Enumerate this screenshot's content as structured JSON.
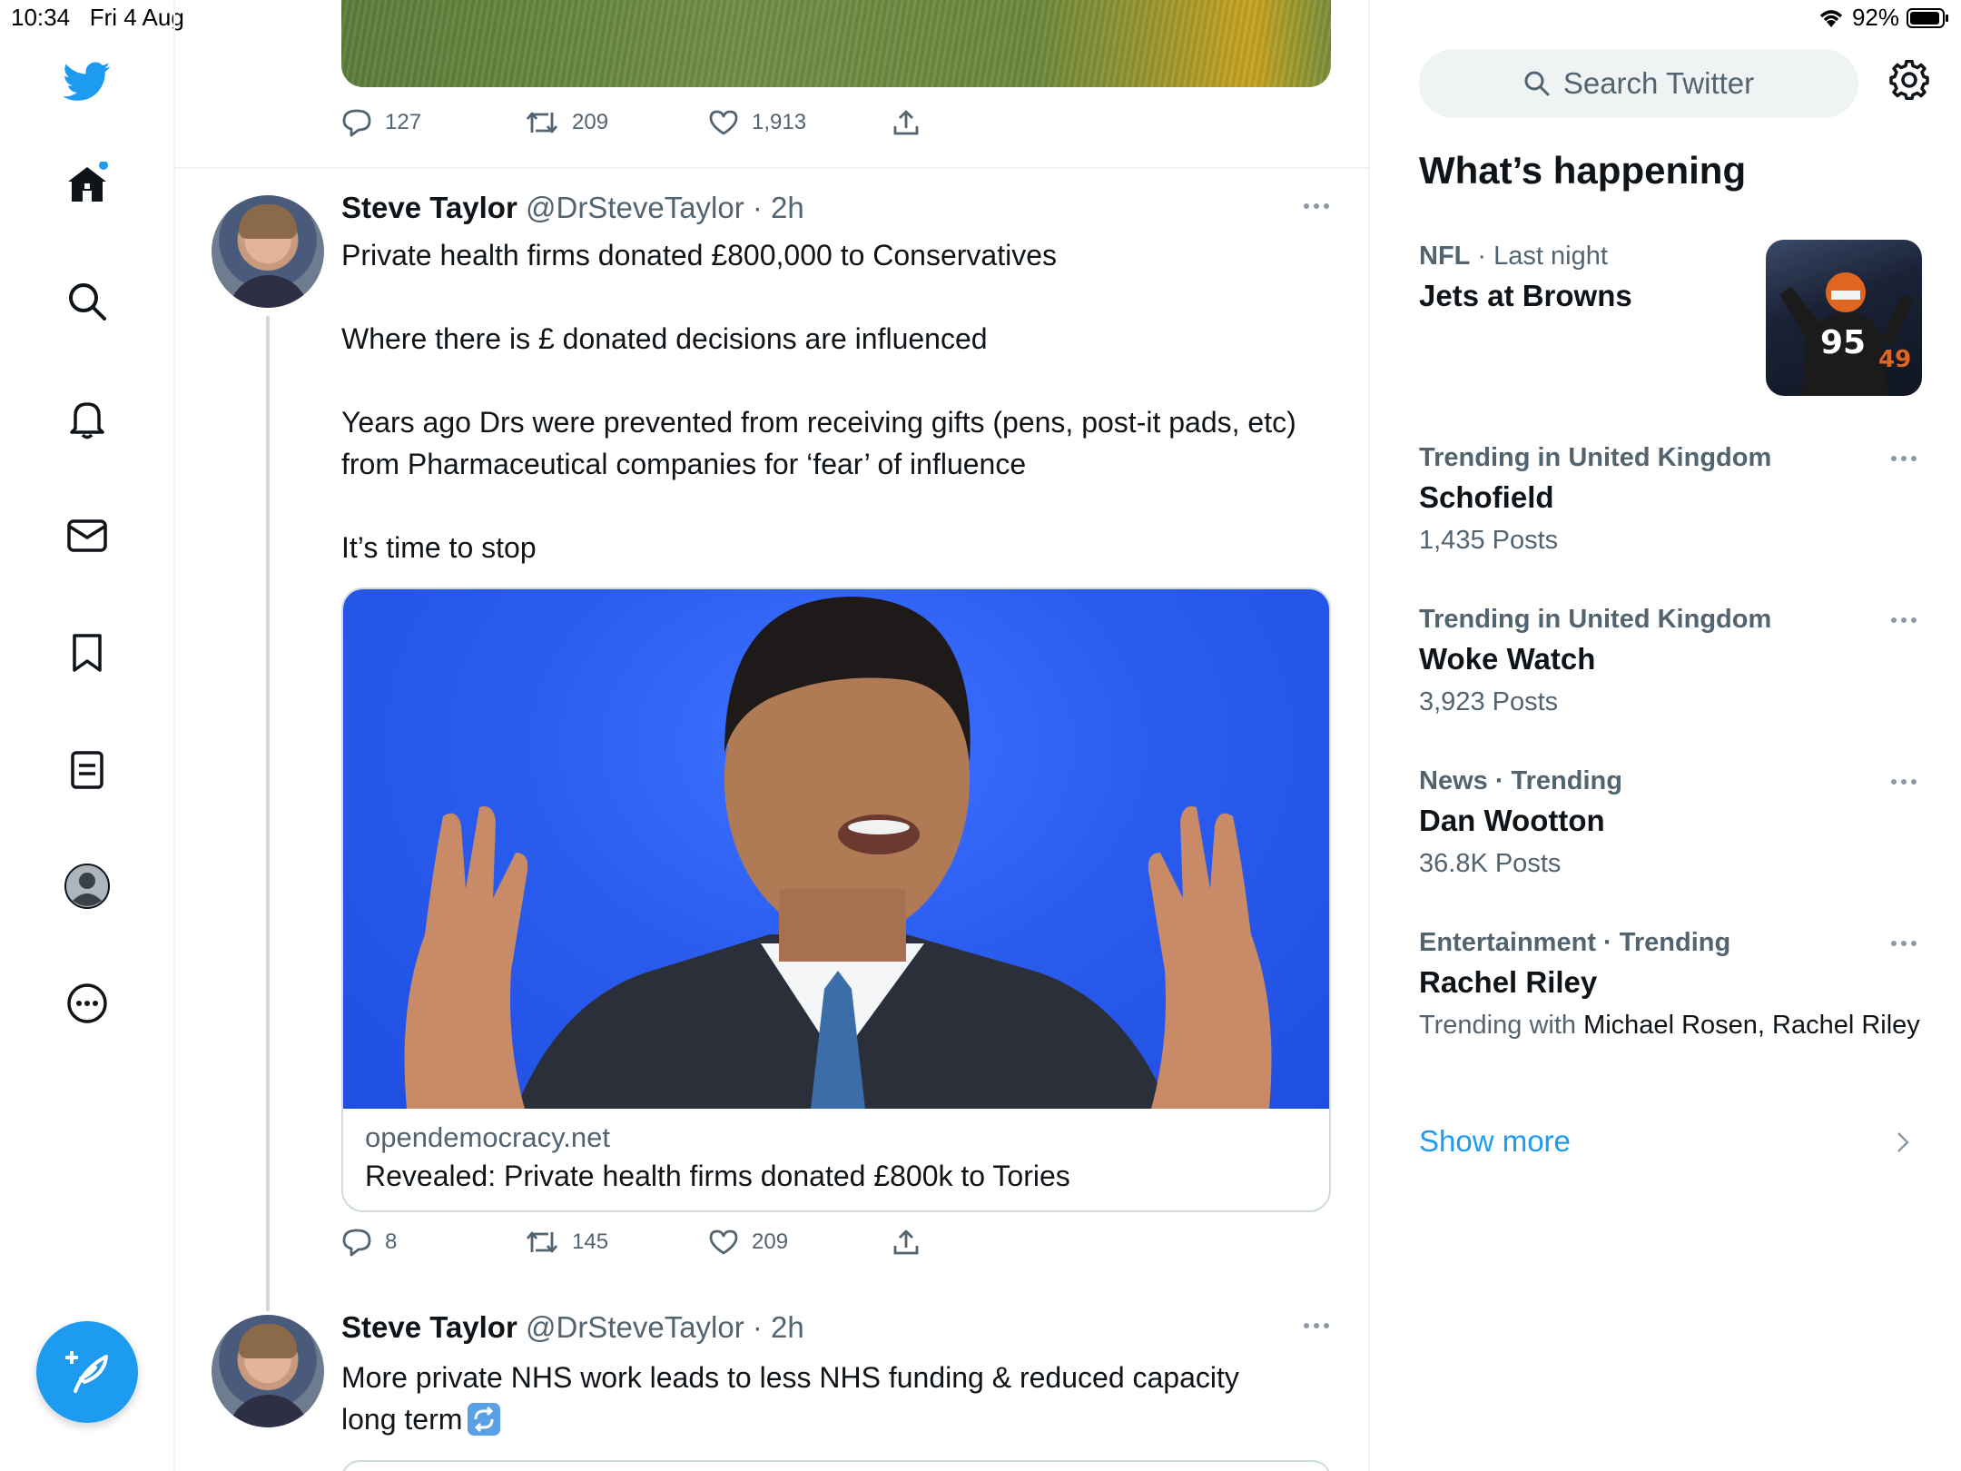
{
  "status_bar": {
    "time": "10:34",
    "date": "Fri 4 Aug",
    "battery": "92%"
  },
  "colors": {
    "accent": "#1d9bf0",
    "text": "#0f1419",
    "secondary": "#536471",
    "border": "#eff3f4"
  },
  "nav": {
    "items": [
      {
        "icon": "twitter-bird-icon"
      },
      {
        "icon": "home-icon"
      },
      {
        "icon": "search-icon"
      },
      {
        "icon": "bell-icon"
      },
      {
        "icon": "mail-icon"
      },
      {
        "icon": "bookmark-icon"
      },
      {
        "icon": "lists-icon"
      },
      {
        "icon": "profile-icon"
      },
      {
        "icon": "more-icon"
      }
    ],
    "compose_icon": "compose-feather-icon"
  },
  "feed": {
    "prev_tweet": {
      "replies": "127",
      "retweets": "209",
      "likes": "1,913"
    },
    "tweet1": {
      "name": "Steve Taylor",
      "handle": "@DrSteveTaylor",
      "time": "· 2h",
      "paragraphs": [
        "Private health firms donated £800,000 to Conservatives",
        "Where there is £ donated decisions are influenced",
        "Years ago Drs were prevented from receiving gifts (pens, post-it pads, etc) from Pharmaceutical companies for ‘fear’ of influence",
        "It’s time to stop"
      ],
      "card": {
        "domain": "opendemocracy.net",
        "title": "Revealed: Private health firms donated £800k to Tories"
      },
      "replies": "8",
      "retweets": "145",
      "likes": "209"
    },
    "tweet2": {
      "name": "Steve Taylor",
      "handle": "@DrSteveTaylor",
      "time": "· 2h",
      "text_line1": "More private NHS work leads to less NHS funding & reduced capacity",
      "text_line2": "long term"
    }
  },
  "sidebar": {
    "search_placeholder": "Search Twitter",
    "section_title": "What’s happening",
    "trends": [
      {
        "category": "NFL",
        "context": " · Last night",
        "name": "Jets at Browns"
      },
      {
        "category": "Trending in United Kingdom",
        "name": "Schofield",
        "count": "1,435 Posts"
      },
      {
        "category": "Trending in United Kingdom",
        "name": "Woke Watch",
        "count": "3,923 Posts"
      },
      {
        "category": "News · Trending",
        "name": "Dan Wootton",
        "count": "36.8K Posts"
      },
      {
        "category": "Entertainment · Trending",
        "name": "Rachel Riley",
        "with_label": "Trending with ",
        "with_names": "Michael Rosen, Rachel Riley"
      }
    ],
    "show_more": "Show more"
  }
}
